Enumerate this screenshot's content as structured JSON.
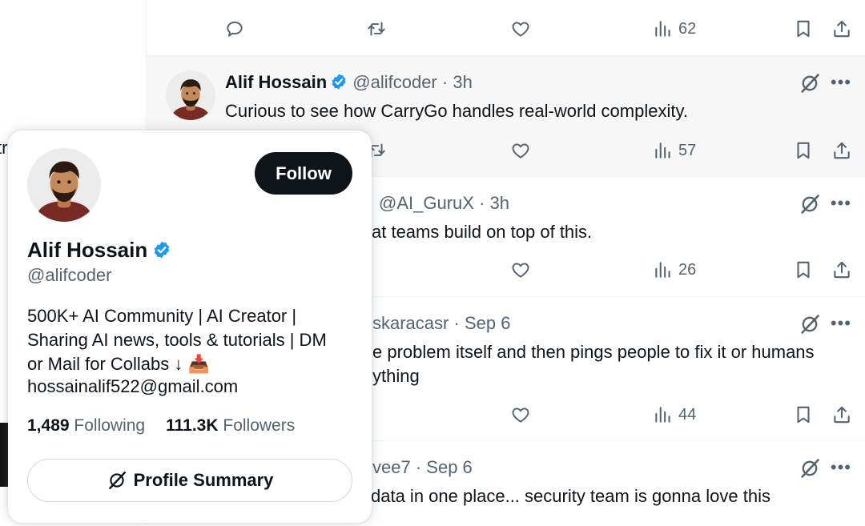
{
  "left_panel": {
    "cut_text": "tr"
  },
  "top_actions": {
    "views": "62"
  },
  "tweets": [
    {
      "name": "Alif Hossain",
      "handle": "@alifcoder",
      "sep": "·",
      "time": "3h",
      "text": "Curious to see how CarryGo handles real-world complexity.",
      "views": "57"
    },
    {
      "handle": "@AI_GuruX",
      "sep": "·",
      "time": "3h",
      "text": "at teams build on top of this.",
      "views": "26"
    },
    {
      "handle": "skaracasr",
      "sep": "·",
      "time": "Sep 6",
      "text": "e problem itself and then pings people to fix it  or humans",
      "text2": "ything",
      "views": "44"
    },
    {
      "handle": "vee7",
      "sep": "·",
      "time": "Sep 6",
      "text": "data in one place... security team is gonna love this"
    }
  ],
  "profile_card": {
    "follow_label": "Follow",
    "name": "Alif Hossain",
    "handle": "@alifcoder",
    "bio_line1": "500K+ AI Community | AI Creator |",
    "bio_line2": "Sharing AI news, tools & tutorials | DM",
    "bio_line3": "or Mail for Collabs ↓ 📥",
    "email": "hossainalif522@gmail.com",
    "following_count": "1,489",
    "following_label": "Following",
    "followers_count": "111.3K",
    "followers_label": "Followers",
    "summary_label": "Profile Summary"
  },
  "icons": {
    "reply": "reply-icon",
    "retweet": "retweet-icon",
    "like": "heart-icon",
    "views": "analytics-icon",
    "bookmark": "bookmark-icon",
    "share": "share-icon",
    "grok": "grok-icon",
    "more": "more-icon",
    "verified": "verified-badge-icon"
  },
  "colors": {
    "verified": "#1d9bf0",
    "text": "#0f1419",
    "muted": "#536471",
    "button_dark": "#0f1419"
  }
}
